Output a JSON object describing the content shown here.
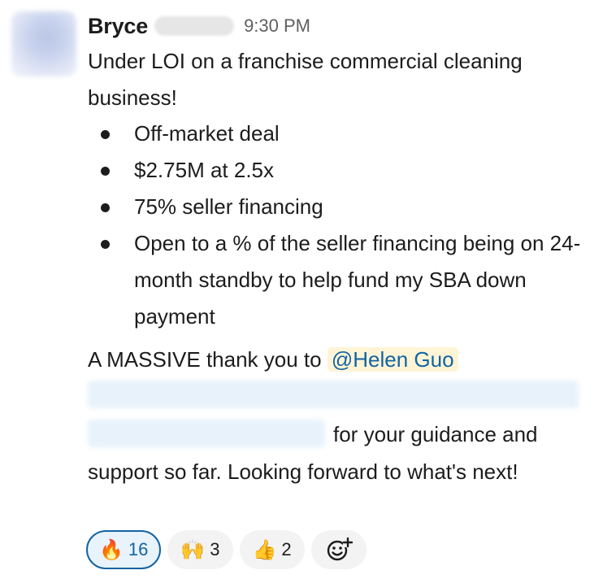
{
  "message": {
    "sender": "Bryce",
    "time": "9:30 PM",
    "intro": "Under LOI on a franchise commercial cleaning business!",
    "bullets": [
      "Off-market deal",
      "$2.75M at 2.5x",
      "75% seller financing",
      "Open to a % of the seller financing being on 24-month standby to help fund my SBA down payment"
    ],
    "thanks_prefix": "A MASSIVE thank you to",
    "mention": "@Helen Guo",
    "tail_line1": "for your guidance and",
    "tail_line2": "support so far. Looking forward to what's next!"
  },
  "reactions": [
    {
      "emoji": "🔥",
      "count": "16",
      "active": true
    },
    {
      "emoji": "🙌",
      "count": "3",
      "active": false
    },
    {
      "emoji": "👍",
      "count": "2",
      "active": false
    }
  ],
  "icons": {
    "add_reaction": "add-reaction-icon"
  }
}
